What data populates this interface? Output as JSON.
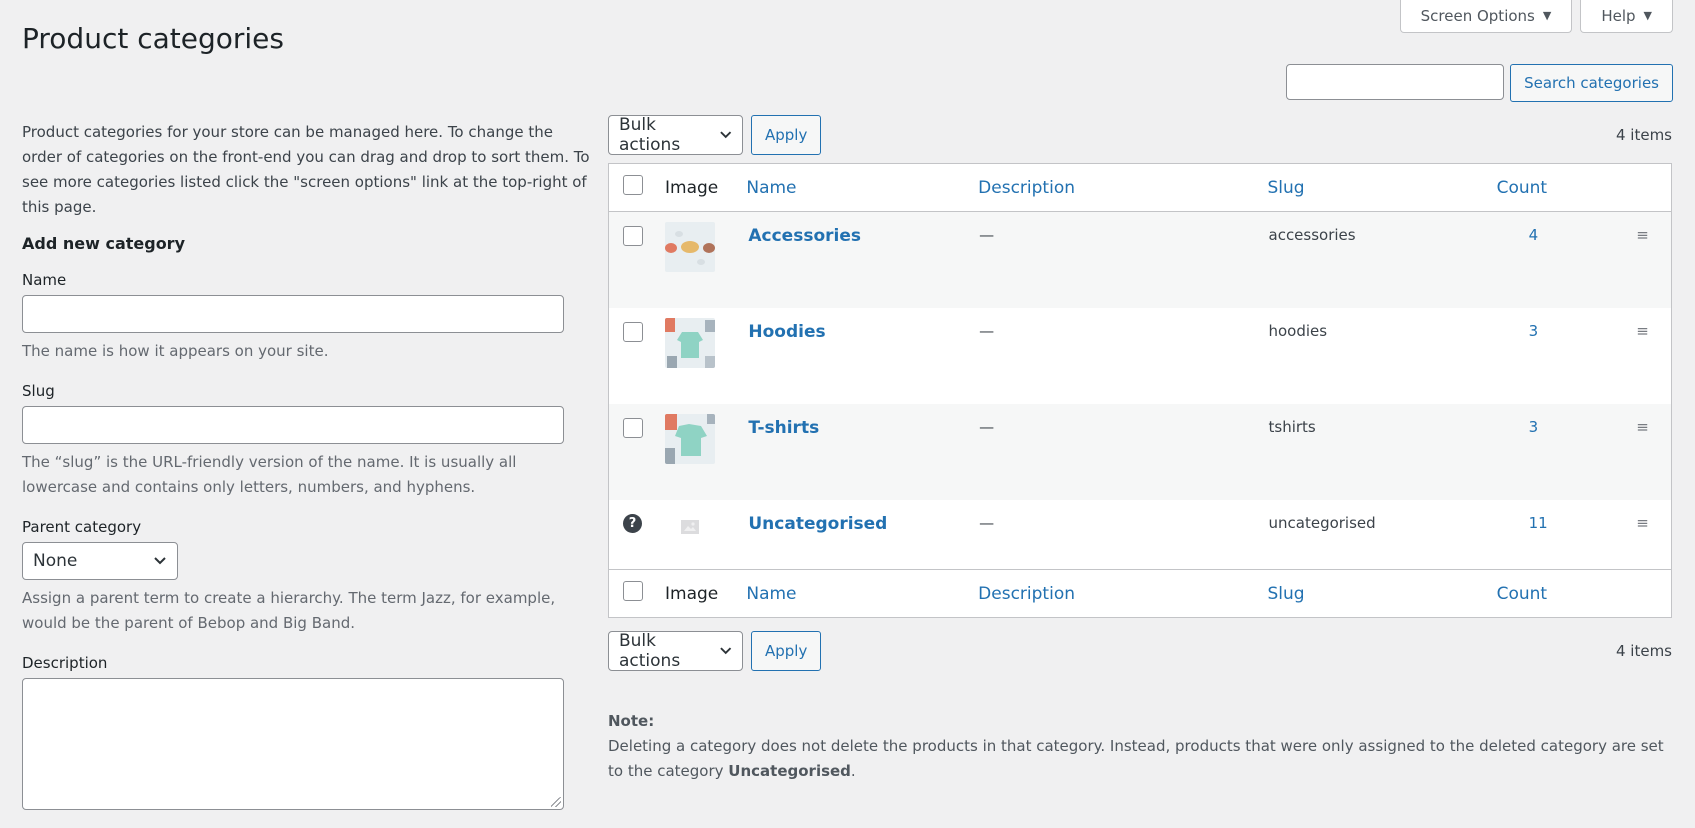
{
  "header": {
    "title": "Product categories",
    "screen_options_label": "Screen Options",
    "help_label": "Help"
  },
  "search": {
    "input_value": "",
    "button_label": "Search categories"
  },
  "form": {
    "intro": "Product categories for your store can be managed here. To change the order of categories on the front-end you can drag and drop to sort them. To see more categories listed click the \"screen options\" link at the top-right of this page.",
    "section_title": "Add new category",
    "name_label": "Name",
    "name_value": "",
    "name_help": "The name is how it appears on your site.",
    "slug_label": "Slug",
    "slug_value": "",
    "slug_help": "The “slug” is the URL-friendly version of the name. It is usually all lowercase and contains only letters, numbers, and hyphens.",
    "parent_label": "Parent category",
    "parent_value": "None",
    "parent_help": "Assign a parent term to create a hierarchy. The term Jazz, for example, would be the parent of Bebop and Big Band.",
    "description_label": "Description",
    "description_value": ""
  },
  "tablenav": {
    "bulk_actions_label": "Bulk actions",
    "apply_label": "Apply",
    "items_count": "4 items"
  },
  "table": {
    "columns": {
      "image": "Image",
      "name": "Name",
      "description": "Description",
      "slug": "Slug",
      "count": "Count"
    },
    "rows": [
      {
        "name": "Accessories",
        "description": "—",
        "slug": "accessories",
        "count": "4",
        "image_icon": "accessories-thumbnail"
      },
      {
        "name": "Hoodies",
        "description": "—",
        "slug": "hoodies",
        "count": "3",
        "image_icon": "hoodies-thumbnail"
      },
      {
        "name": "T-shirts",
        "description": "—",
        "slug": "tshirts",
        "count": "3",
        "image_icon": "tshirts-thumbnail"
      },
      {
        "name": "Uncategorised",
        "description": "—",
        "slug": "uncategorised",
        "count": "11",
        "image_icon": "placeholder-image-icon",
        "row_icon": "?"
      }
    ]
  },
  "note": {
    "title": "Note:",
    "text_before": "Deleting a category does not delete the products in that category. Instead, products that were only assigned to the deleted category are set to the category ",
    "emphasis": "Uncategorised",
    "text_after": "."
  },
  "colors": {
    "link": "#2271b1",
    "background": "#f0f0f1",
    "alt_row": "#f6f7f7"
  }
}
